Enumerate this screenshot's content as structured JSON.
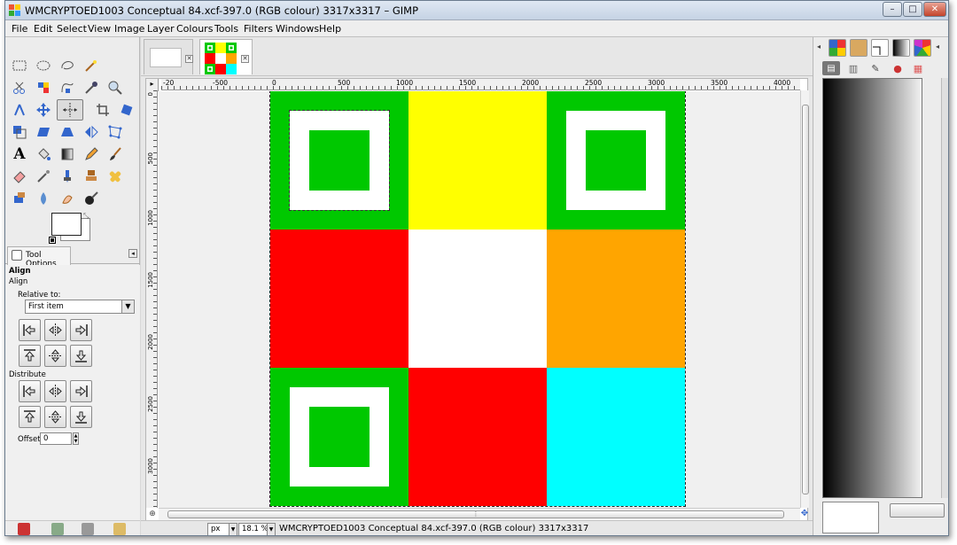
{
  "window": {
    "title": "WMCRYPTOED1003 Conceptual 84.xcf-397.0 (RGB colour) 3317x3317 – GIMP",
    "controls": {
      "minimize": "–",
      "maximize": "□",
      "close": "✕"
    }
  },
  "menubar": {
    "items": [
      "File",
      "Edit",
      "Select",
      "View",
      "Image",
      "Layer",
      "Colours",
      "Tools",
      "Filters",
      "Windows",
      "Help"
    ]
  },
  "toolbox": {
    "tools": [
      "rect-select-icon",
      "ellipse-select-icon",
      "free-select-icon",
      "fuzzy-select-icon",
      "scissors-select-icon",
      "color-select-icon",
      "paths-icon",
      "color-picker-icon",
      "zoom-icon",
      "measure-icon",
      "move-icon",
      "align-icon",
      "crop-icon",
      "rotate-icon",
      "scale-icon",
      "shear-icon",
      "perspective-icon",
      "flip-icon",
      "cage-icon",
      "text-icon",
      "bucket-fill-icon",
      "blend-icon",
      "pencil-icon",
      "paintbrush-icon",
      "eraser-icon",
      "airbrush-icon",
      "ink-icon",
      "clone-icon",
      "heal-icon",
      "perspective-clone-icon",
      "blur-icon",
      "smudge-icon",
      "dodge-burn-icon"
    ],
    "active_tool": "align-icon"
  },
  "tool_options": {
    "tab_label": "Tool Options",
    "section_title": "Align",
    "section_sub": "Align",
    "relative_label": "Relative to:",
    "relative_value": "First item",
    "distribute_label": "Distribute",
    "offset_label": "Offset:",
    "offset_value": "0"
  },
  "image_window": {
    "ruler_h_labels": [
      "-20",
      "-500",
      "0",
      "500",
      "1000",
      "1500",
      "2000",
      "2500",
      "3000",
      "3500",
      "4000"
    ],
    "ruler_v_labels": [
      "0",
      "500",
      "1000",
      "1500",
      "2000",
      "2500",
      "3000"
    ],
    "status": {
      "unit": "px",
      "zoom": "18.1 %",
      "text": "WMCRYPTOED1003 Conceptual 84.xcf-397.0 (RGB colour) 3317x3317"
    }
  },
  "artwork": {
    "grid": [
      [
        "marker",
        "yellow",
        "marker"
      ],
      [
        "red",
        "white",
        "orange"
      ],
      [
        "marker",
        "red",
        "cyan"
      ]
    ],
    "colors": {
      "green": "#00c800",
      "yellow": "#ffff00",
      "red": "#ff0000",
      "white": "#ffffff",
      "orange": "#ffa500",
      "cyan": "#00ffff"
    }
  },
  "right_dock": {
    "tabs": [
      "palette-icon",
      "brushes-icon",
      "patterns-icon",
      "gradient-icon",
      "fonts-icon"
    ],
    "subtabs": [
      "layers-icon",
      "channels-icon",
      "paths-dock-icon",
      "colormap-icon",
      "histogram-icon"
    ]
  }
}
